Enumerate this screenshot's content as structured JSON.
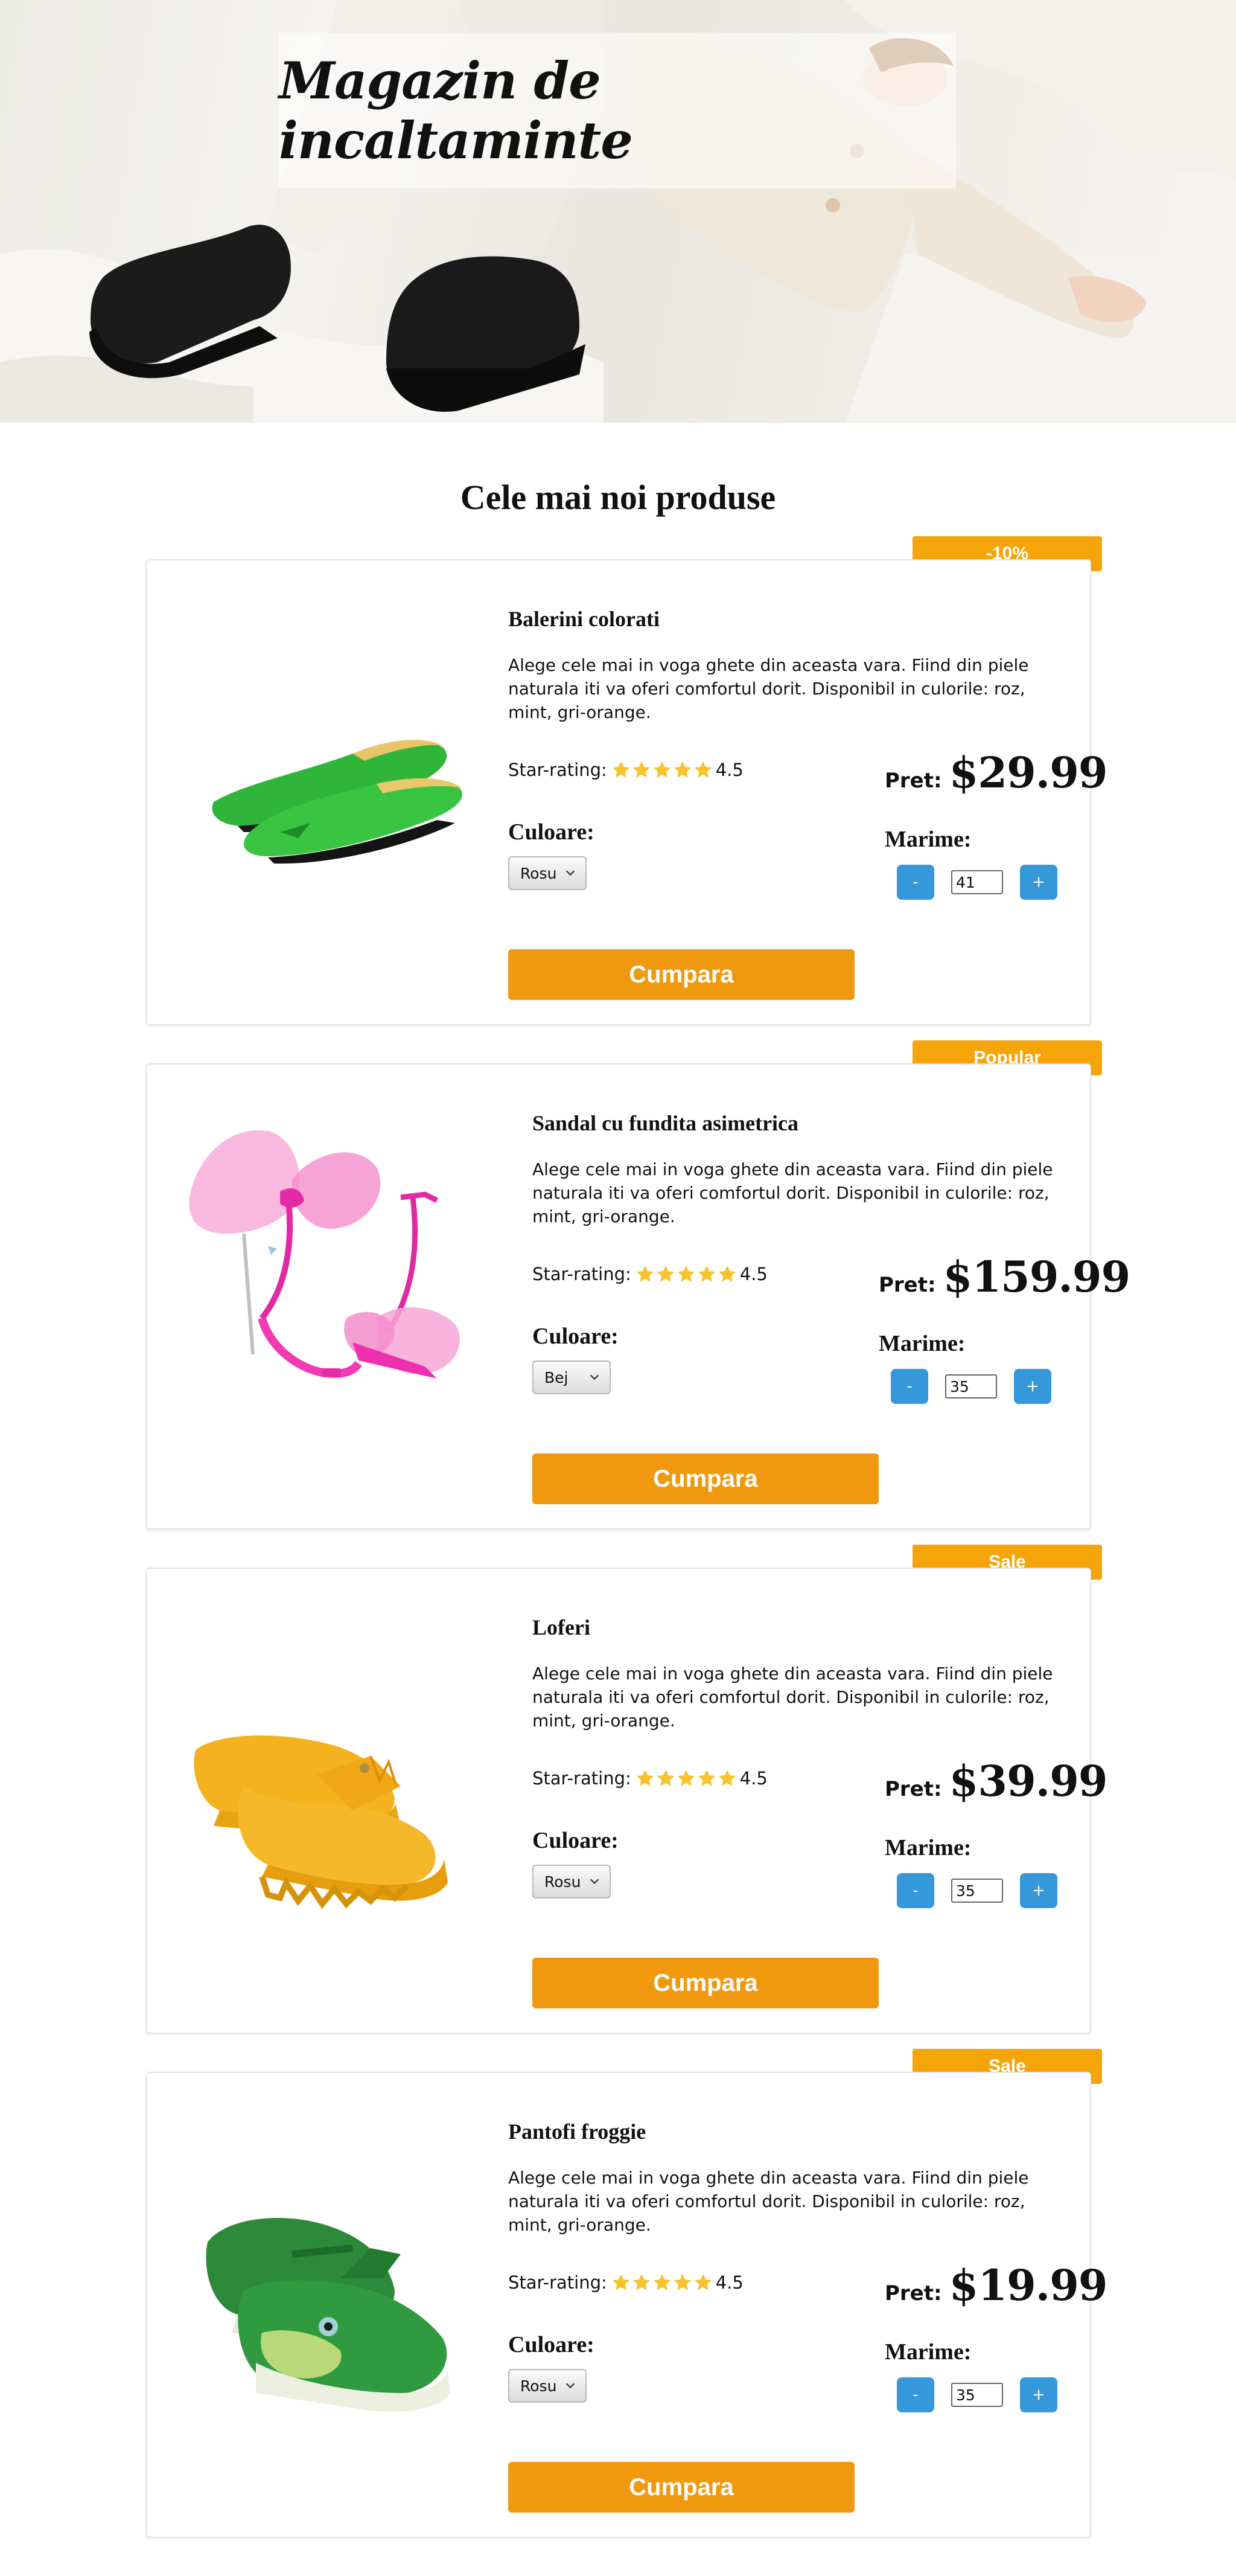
{
  "hero": {
    "title": "Magazin de incaltaminte"
  },
  "section_title": "Cele mai noi produse",
  "labels": {
    "rating": "Star-rating:",
    "colour": "Culoare:",
    "price": "Pret:",
    "size": "Marime:",
    "minus": "-",
    "plus": "+",
    "buy": "Cumpara"
  },
  "products": [
    {
      "badge": "-10%",
      "name": "Balerini colorati",
      "description": "Alege cele mai in voga ghete din aceasta vara. Fiind din piele naturala iti va oferi comfortul dorit. Disponibil in culorile: roz, mint, gri-orange.",
      "rating": "4.5",
      "colour": "Rosu",
      "price": "$29.99",
      "size": "41",
      "image_icon": "green-ballet-flats"
    },
    {
      "badge": "Popular",
      "name": "Sandal cu fundita asimetrica",
      "description": "Alege cele mai in voga ghete din aceasta vara. Fiind din piele naturala iti va oferi comfortul dorit. Disponibil in culorile: roz, mint, gri-orange.",
      "rating": "4.5",
      "colour": "Bej",
      "price": "$159.99",
      "size": "35",
      "image_icon": "pink-bow-sandals"
    },
    {
      "badge": "Sale",
      "name": "Loferi",
      "description": "Alege cele mai in voga ghete din aceasta vara. Fiind din piele naturala iti va oferi comfortul dorit. Disponibil in culorile: roz, mint, gri-orange.",
      "rating": "4.5",
      "colour": "Rosu",
      "price": "$39.99",
      "size": "35",
      "image_icon": "yellow-loafers"
    },
    {
      "badge": "Sale",
      "name": "Pantofi froggie",
      "description": "Alege cele mai in voga ghete din aceasta vara. Fiind din piele naturala iti va oferi comfortul dorit. Disponibil in culorile: roz, mint, gri-orange.",
      "rating": "4.5",
      "colour": "Rosu",
      "price": "$19.99",
      "size": "35",
      "image_icon": "green-frog-shoes"
    }
  ],
  "colors": {
    "badge": "#f5a50a",
    "buy_button": "#f0990f",
    "stepper": "#3598db",
    "star": "#f7c32e"
  }
}
